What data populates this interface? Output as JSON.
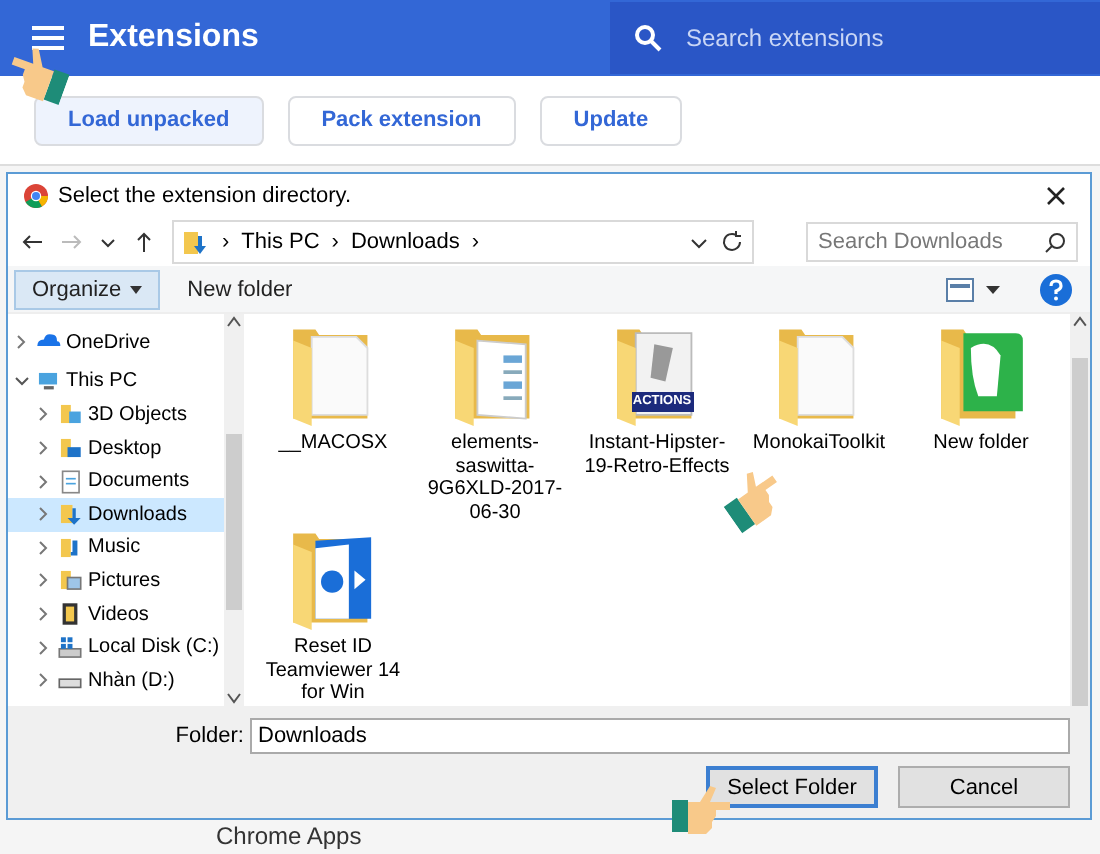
{
  "app_bar": {
    "title": "Extensions",
    "search_placeholder": "Search extensions"
  },
  "toolbar": [
    {
      "label": "Load unpacked",
      "selected": true
    },
    {
      "label": "Pack extension",
      "selected": false
    },
    {
      "label": "Update",
      "selected": false
    }
  ],
  "dialog": {
    "title": "Select the extension directory.",
    "breadcrumbs": [
      "This PC",
      "Downloads"
    ],
    "separator": "›",
    "search_placeholder": "Search Downloads",
    "commands": [
      {
        "label": "Organize",
        "kind": "menu"
      },
      {
        "label": "New folder",
        "kind": "plain"
      }
    ],
    "tree": [
      {
        "label": "OneDrive",
        "kind": "cloud",
        "expanded": false,
        "selected": false
      },
      {
        "label": "This PC",
        "kind": "pc",
        "expanded": true,
        "selected": false,
        "children": [
          {
            "label": "3D Objects",
            "kind": "cube",
            "expanded": false,
            "selected": false
          },
          {
            "label": "Desktop",
            "kind": "desktop",
            "expanded": false,
            "selected": false
          },
          {
            "label": "Documents",
            "kind": "document",
            "expanded": false,
            "selected": false
          },
          {
            "label": "Downloads",
            "kind": "download",
            "expanded": false,
            "selected": true
          },
          {
            "label": "Music",
            "kind": "music",
            "expanded": false,
            "selected": false
          },
          {
            "label": "Pictures",
            "kind": "pictures",
            "expanded": false,
            "selected": false
          },
          {
            "label": "Videos",
            "kind": "video",
            "expanded": false,
            "selected": false
          },
          {
            "label": "Local Disk (C:)",
            "kind": "disk",
            "expanded": false,
            "selected": false
          },
          {
            "label": "Nhàn (D:)",
            "kind": "drive",
            "expanded": false,
            "selected": false
          }
        ]
      }
    ],
    "files": [
      {
        "name": "__MACOSX",
        "kind": "blank"
      },
      {
        "name": "elements-saswitta-9G6XLD-2017-06-30",
        "kind": "document"
      },
      {
        "name": "Instant-Hipster-19-Retro-Effects",
        "kind": "actions",
        "icon_label": "ACTIONS"
      },
      {
        "name": "MonokaiToolkit",
        "kind": "blank"
      },
      {
        "name": "New folder",
        "kind": "green"
      },
      {
        "name": "Reset ID Teamviewer 14 for Win",
        "kind": "blue"
      }
    ],
    "folder_field": {
      "label": "Folder:",
      "value": "Downloads"
    },
    "buttons": [
      {
        "label": "Select Folder",
        "default": true
      },
      {
        "label": "Cancel",
        "default": false
      }
    ]
  },
  "page_text": "Chrome Apps"
}
